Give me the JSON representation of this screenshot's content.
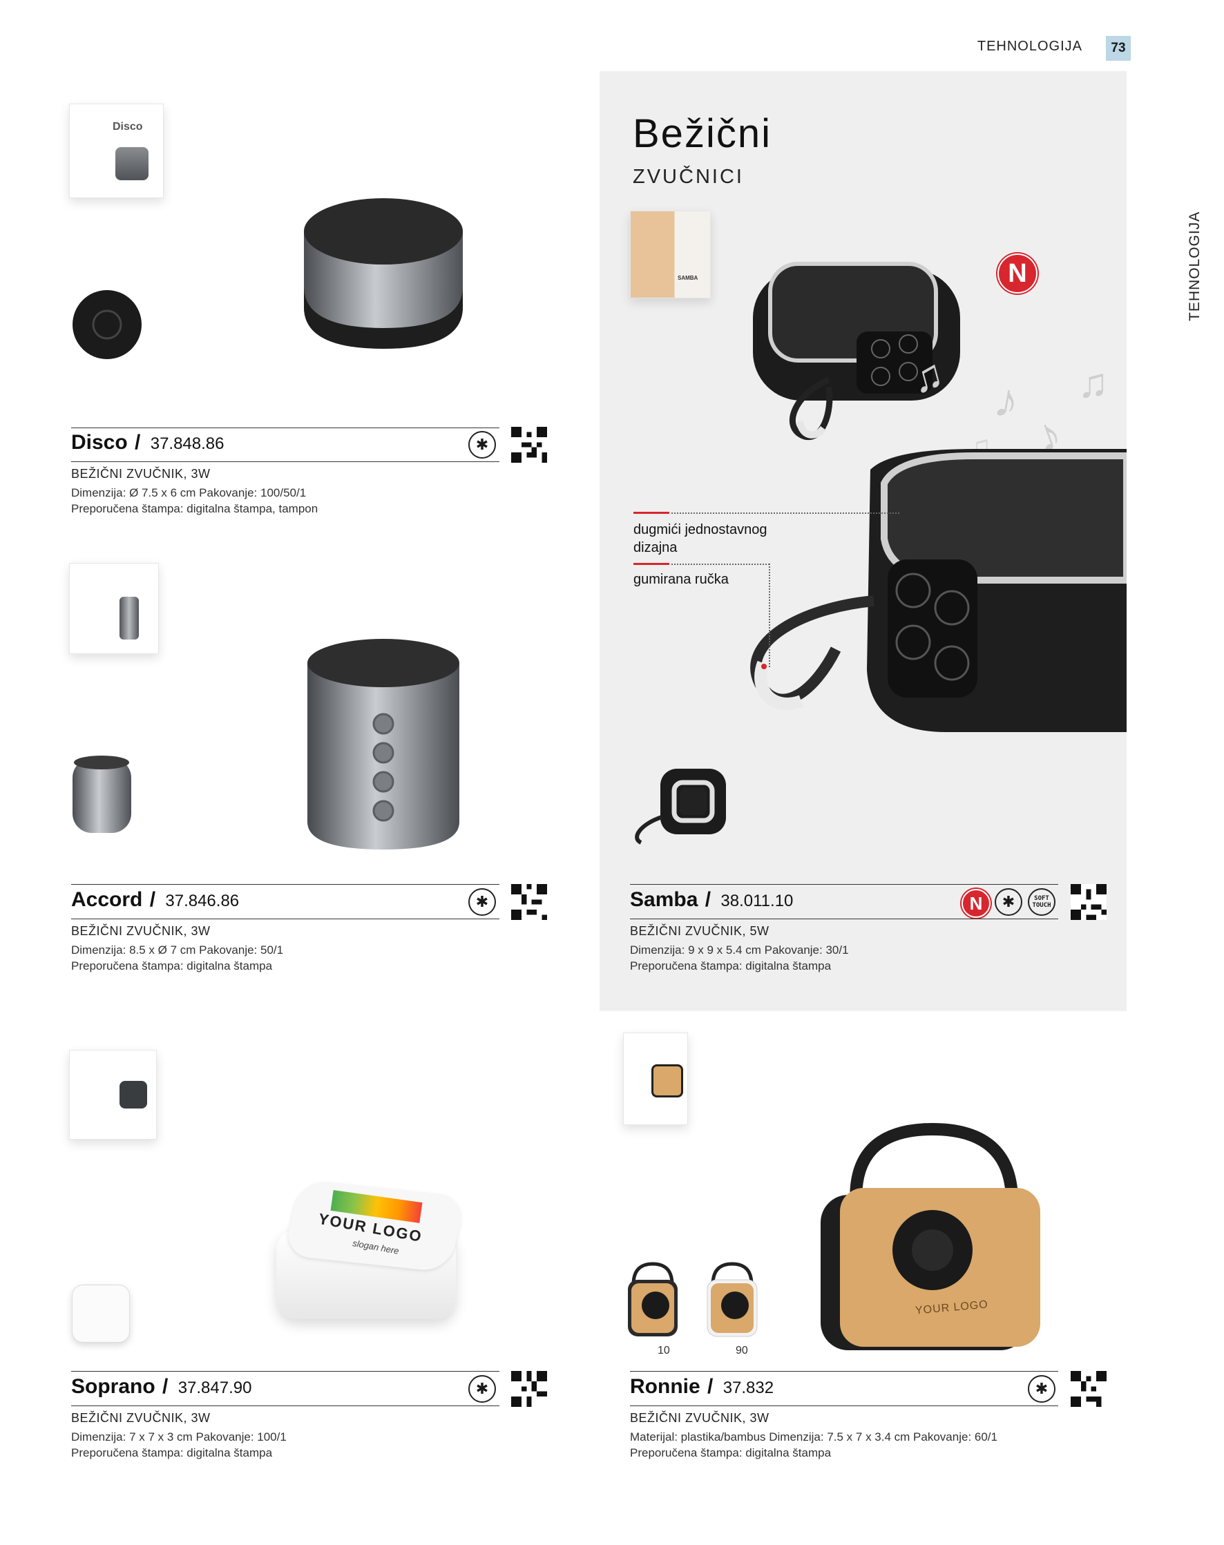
{
  "header": {
    "section": "TEHNOLOGIJA",
    "page_number": "73",
    "side_tab": "TEHNOLOGIJA"
  },
  "hero": {
    "title": "Bežični",
    "subtitle": "ZVUČNICI",
    "new_badge": "N"
  },
  "callouts": [
    {
      "label": "dugmići jednostavnog dizajna"
    },
    {
      "label": "gumirana ručka"
    }
  ],
  "products": [
    {
      "name": "Disco",
      "code": "37.848.86",
      "type": "BEŽIČNI ZVUČNIK, 3W",
      "line1": "Dimenzija: Ø 7.5 x 6 cm Pakovanje: 100/50/1",
      "line2": "Preporučena štampa: digitalna štampa, tampon"
    },
    {
      "name": "Accord",
      "code": "37.846.86",
      "type": "BEŽIČNI ZVUČNIK, 3W",
      "line1": "Dimenzija: 8.5 x Ø 7 cm Pakovanje: 50/1",
      "line2": "Preporučena štampa: digitalna štampa"
    },
    {
      "name": "Samba",
      "code": "38.011.10",
      "type": "BEŽIČNI ZVUČNIK, 5W",
      "line1": "Dimenzija: 9 x 9 x 5.4 cm Pakovanje: 30/1",
      "line2": "Preporučena štampa: digitalna štampa",
      "badge_new": "N",
      "badge_soft": "SOFT TOUCH"
    },
    {
      "name": "Soprano",
      "code": "37.847.90",
      "type": "BEŽIČNI ZVUČNIK, 3W",
      "line1": "Dimenzija: 7 x 7 x 3 cm Pakovanje: 100/1",
      "line2": "Preporučena štampa: digitalna štampa",
      "print_demo": {
        "logo": "YOUR LOGO",
        "slogan": "slogan here"
      }
    },
    {
      "name": "Ronnie",
      "code": "37.832",
      "type": "BEŽIČNI ZVUČNIK, 3W",
      "line1": "Materijal: plastika/bambus Dimenzija: 7.5 x 7 x 3.4 cm Pakovanje: 60/1",
      "line2": "Preporučena štampa: digitalna štampa",
      "variants": [
        "10",
        "90"
      ],
      "print_demo": {
        "logo": "YOUR LOGO"
      }
    }
  ],
  "box_labels": {
    "disco": "Disco",
    "samba": "SAMBA"
  },
  "icons": {
    "bluetooth": "bluetooth-icon",
    "qr": "qr-code-icon",
    "music": "music-note-icon"
  },
  "colors": {
    "accent_red": "#d7262e",
    "panel_bg": "#efefef",
    "page_tab": "#bcd7e6",
    "bamboo": "#d9a86a"
  }
}
